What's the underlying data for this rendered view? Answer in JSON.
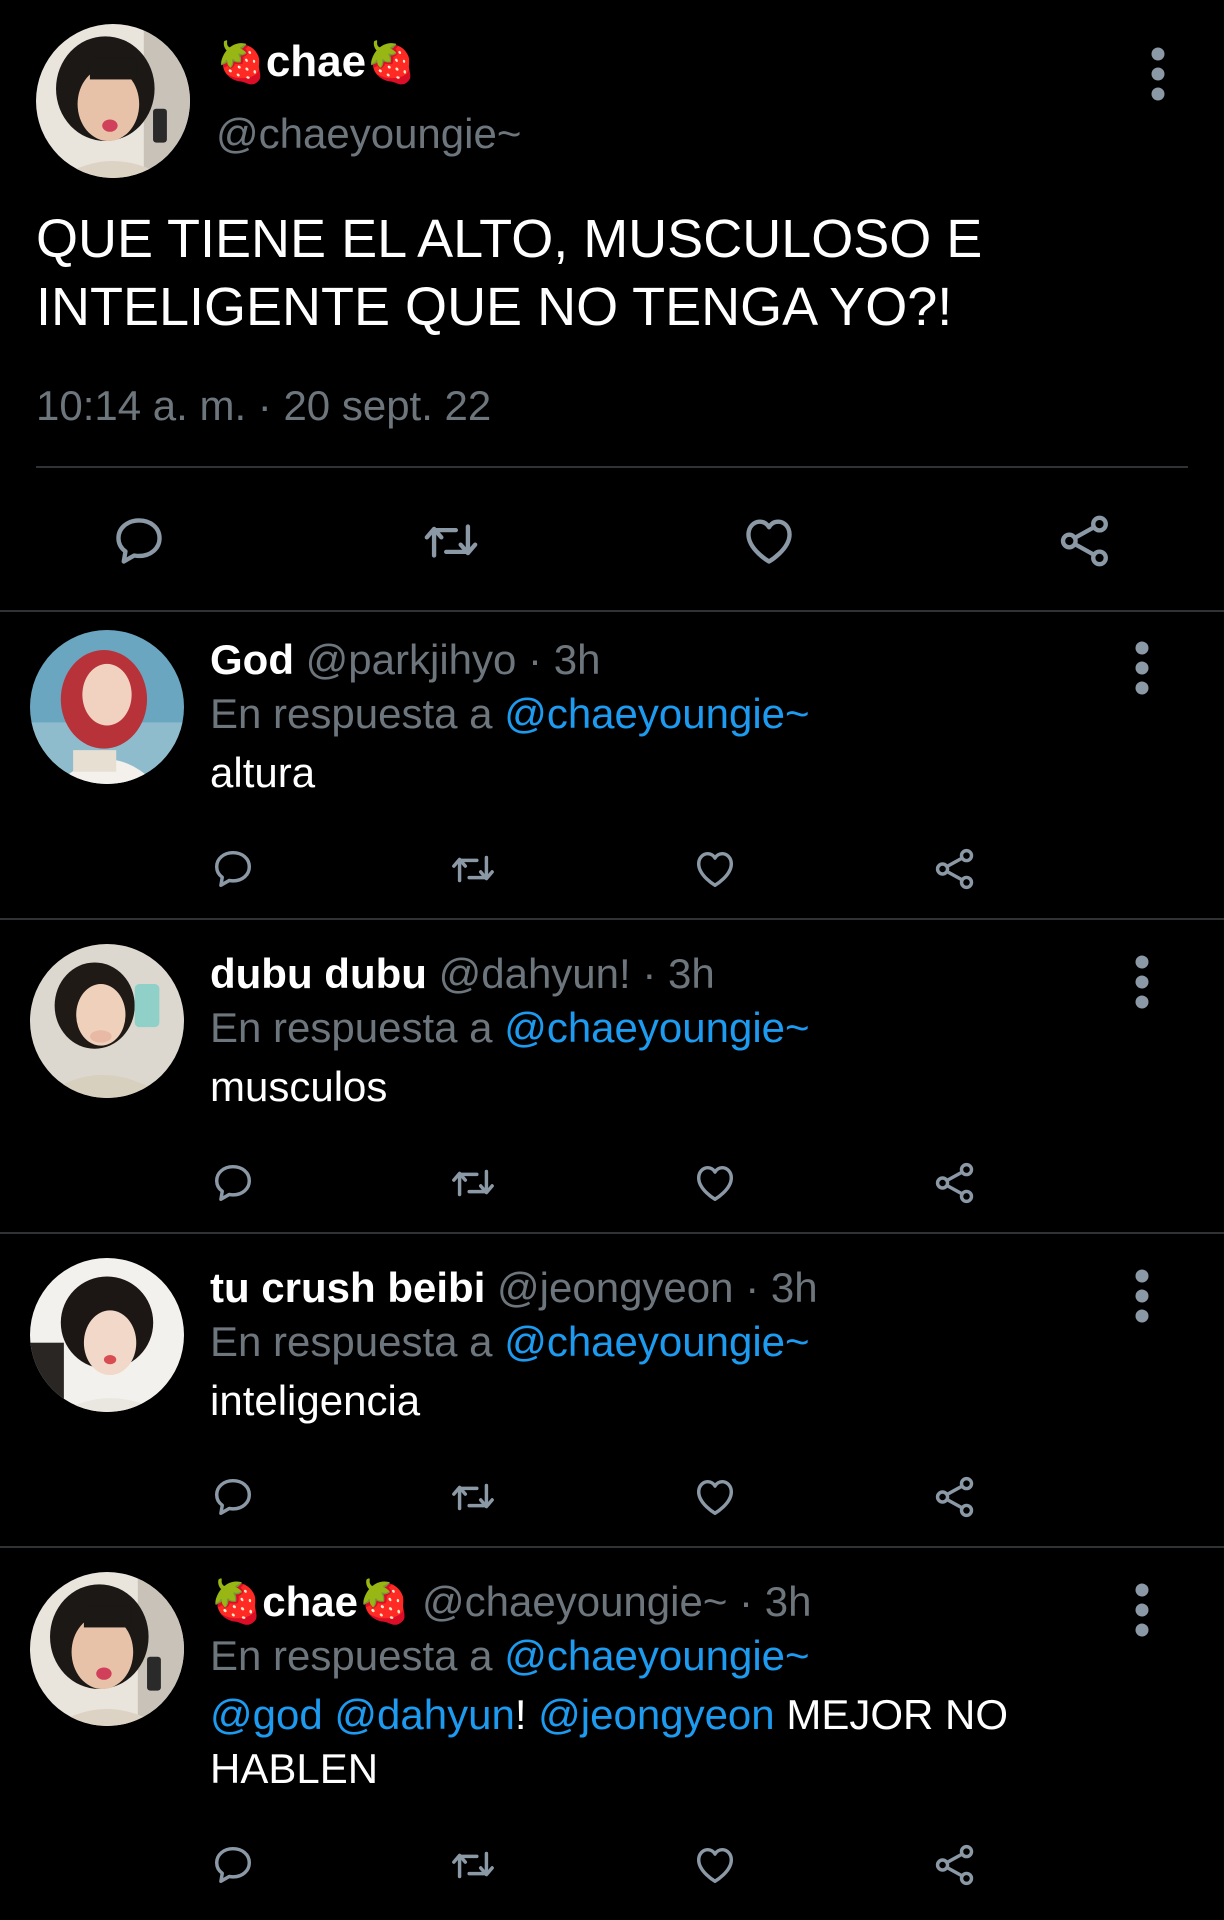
{
  "main_tweet": {
    "display_name": "chae",
    "emoji": "🍓",
    "handle": "@chaeyoungie~",
    "text": "QUE TIENE EL ALTO, MUSCULOSO E\nINTELIGENTE QUE NO TENGA YO?!",
    "timestamp": "10:14 a. m. · 20 sept. 22"
  },
  "reply_prefix": "En respuesta a",
  "reply_target": "@chaeyoungie~",
  "replies": [
    {
      "name": "God",
      "handle": "@parkjihyo",
      "time": "3h",
      "text": "altura"
    },
    {
      "name": "dubu dubu",
      "handle": "@dahyun!",
      "time": "3h",
      "text": "musculos"
    },
    {
      "name": "tu crush beibi",
      "handle": "@jeongyeon",
      "time": "3h",
      "text": "inteligencia"
    },
    {
      "name": "chae",
      "emoji": "🍓",
      "handle": "@chaeyoungie~",
      "time": "3h",
      "mentions": [
        "@god",
        "@dahyun",
        "@jeongyeon"
      ],
      "text_exclaim": "!",
      "text_tail": "MEJOR NO HABLEN"
    }
  ],
  "separator": "·",
  "icons": {
    "reply": "reply-icon",
    "retweet": "retweet-icon",
    "like": "heart-icon",
    "share": "share-icon",
    "more": "more-vertical-icon"
  },
  "colors": {
    "background": "#000000",
    "text": "#ffffff",
    "muted": "#6e767d",
    "accent": "#1d9bf0",
    "divider": "#2f3336"
  }
}
